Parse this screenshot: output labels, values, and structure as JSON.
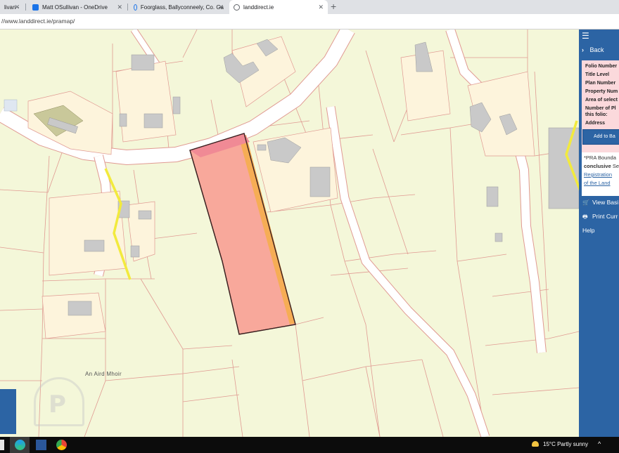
{
  "browser": {
    "tabs": [
      {
        "label": "livan - ",
        "icon": "outlook-icon",
        "color": "#0a64c8"
      },
      {
        "label": "Matt OSullivan - OneDrive",
        "icon": "onedrive-icon",
        "color": "#1a73e8"
      },
      {
        "label": "Foorglass, Ballyconneely, Co. Ga",
        "icon": "globe-icon",
        "color": "#1a73e8"
      },
      {
        "label": "landdirect.ie",
        "icon": "globe-icon",
        "color": "#5f6368"
      }
    ],
    "new_tab": "+",
    "close_glyph": "✕",
    "url": "//www.landdirect.ie/pramap/"
  },
  "map": {
    "place_label": "An Aird Mhoir",
    "field_fill": "#f4f7d9",
    "boundary_color": "#e09a92",
    "road_fill": "#ffffff",
    "selected_parcel_fill": "#f8a89b",
    "selected_strip_fill": "#f6ad55",
    "highlight_color": "#f2ea3d",
    "building_fill": "#c9c9c9",
    "watermark": "P"
  },
  "panel": {
    "menu_icon": "☰",
    "back_label": "Back",
    "fields": [
      "Folio Number",
      "Title Level",
      "Plan Number",
      "Property Num",
      "Area of select",
      "Number of Pl",
      "this folio:",
      "Address"
    ],
    "add_button": "Add to Ba",
    "note": {
      "line1": "*PRA Bounda",
      "line2_bold": "conclusive",
      "line2_rest": " Se",
      "link1": "Registration",
      "link2": "of the Land"
    },
    "links": [
      {
        "label": "View Basi",
        "icon": "cart-icon",
        "glyph": "🛒"
      },
      {
        "label": "Print Curr",
        "icon": "printer-icon",
        "glyph": "🖶"
      },
      {
        "label": "Help",
        "icon": "",
        "glyph": ""
      }
    ]
  },
  "taskbar": {
    "weather": "15°C  Partly sunny",
    "tray": "^"
  }
}
